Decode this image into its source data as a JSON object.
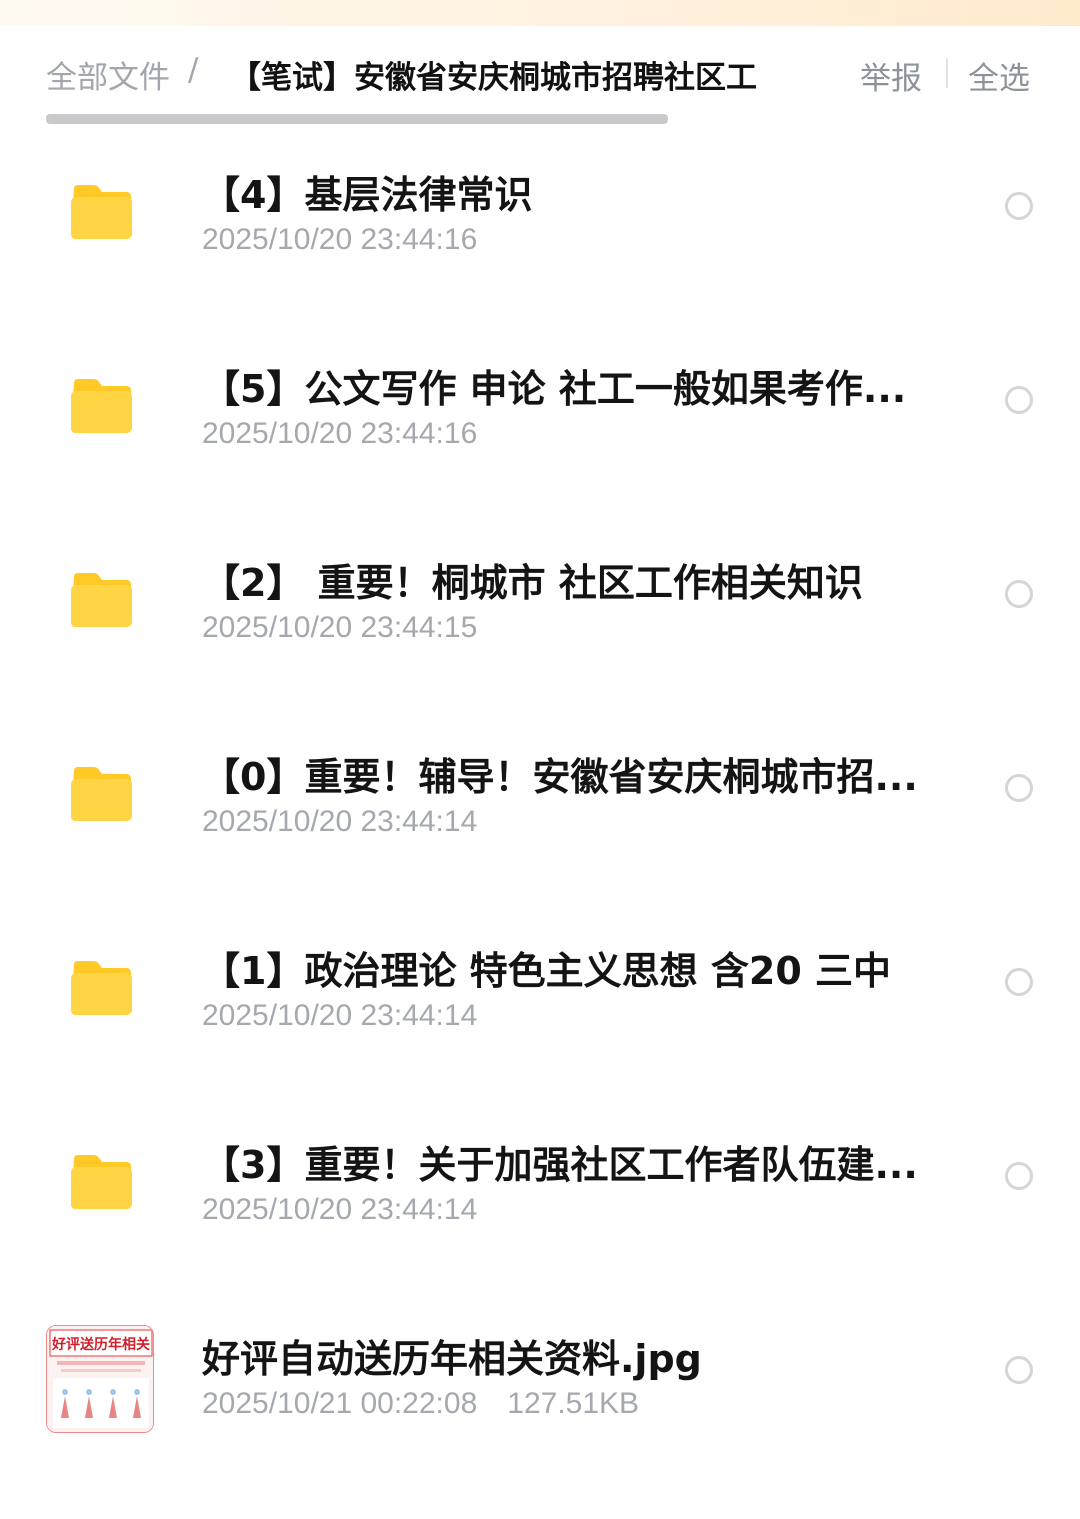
{
  "header": {
    "breadcrumb_root": "全部文件",
    "breadcrumb_separator": "/",
    "current_folder": "【笔试】安徽省安庆桐城市招聘社区工",
    "report_label": "举报",
    "select_all_label": "全选"
  },
  "files": [
    {
      "type": "folder",
      "icon": "folder-icon",
      "name": "【4】基层法律常识",
      "modified": "2025/10/20 23:44:16"
    },
    {
      "type": "folder",
      "icon": "folder-icon",
      "name": "【5】公文写作 申论 社工一般如果考作...",
      "modified": "2025/10/20 23:44:16"
    },
    {
      "type": "folder",
      "icon": "folder-icon",
      "name": "【2】 重要！桐城市 社区工作相关知识",
      "modified": "2025/10/20 23:44:15"
    },
    {
      "type": "folder",
      "icon": "folder-icon",
      "name": "【0】重要！辅导！安徽省安庆桐城市招...",
      "modified": "2025/10/20 23:44:14"
    },
    {
      "type": "folder",
      "icon": "folder-icon",
      "name": "【1】政治理论 特色主义思想 含20 三中",
      "modified": "2025/10/20 23:44:14"
    },
    {
      "type": "folder",
      "icon": "folder-icon",
      "name": "【3】重要！关于加强社区工作者队伍建...",
      "modified": "2025/10/20 23:44:14"
    },
    {
      "type": "image",
      "icon": "image-thumbnail",
      "name": "好评自动送历年相关资料.jpg",
      "modified": "2025/10/21 00:22:08",
      "size": "127.51KB",
      "thumb_text": "好评送历年相关"
    }
  ],
  "colors": {
    "folder": "#ffd445",
    "folder_tab": "#ffc928",
    "title_text": "#141414",
    "meta_text": "#a5a8ae",
    "breadcrumb_text": "#a3a6ad",
    "radio_border": "#d3d5d9"
  }
}
